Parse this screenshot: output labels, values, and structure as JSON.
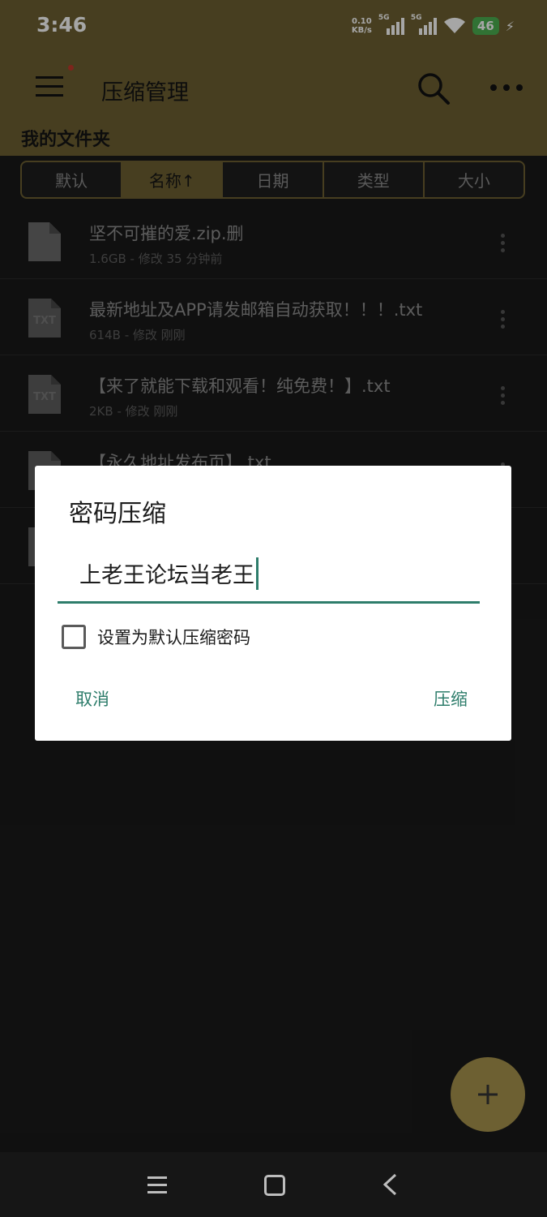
{
  "status_bar": {
    "time": "3:46",
    "net_speed_value": "0.10",
    "net_speed_unit": "KB/s",
    "signal1_label": "5G",
    "signal2_label": "5G",
    "battery": "46"
  },
  "app_bar": {
    "title": "压缩管理",
    "folder_label": "我的文件夹"
  },
  "sort_tabs": [
    {
      "label": "默认"
    },
    {
      "label": "名称↑"
    },
    {
      "label": "日期"
    },
    {
      "label": "类型"
    },
    {
      "label": "大小"
    }
  ],
  "files": [
    {
      "name": "坚不可摧的爱.zip.删",
      "meta": "1.6GB - 修改 35 分钟前",
      "icon": "blank-file-icon"
    },
    {
      "name": "最新地址及APP请发邮箱自动获取！！！.txt",
      "meta": "614B - 修改 刚刚",
      "icon": "txt-file-icon",
      "icon_text": "TXT"
    },
    {
      "name": "【来了就能下载和观看！纯免费！】.txt",
      "meta": "2KB - 修改 刚刚",
      "icon": "txt-file-icon",
      "icon_text": "TXT"
    },
    {
      "name": "【永久地址发布页】.txt",
      "meta": "",
      "icon": "txt-file-icon",
      "icon_text": ""
    }
  ],
  "dialog": {
    "title": "密码压缩",
    "password_value": "上老王论坛当老王",
    "checkbox_label": "设置为默认压缩密码",
    "cancel_label": "取消",
    "confirm_label": "压缩"
  },
  "colors": {
    "accent": "#6d6032",
    "dialog_accent": "#2e7d6b"
  }
}
